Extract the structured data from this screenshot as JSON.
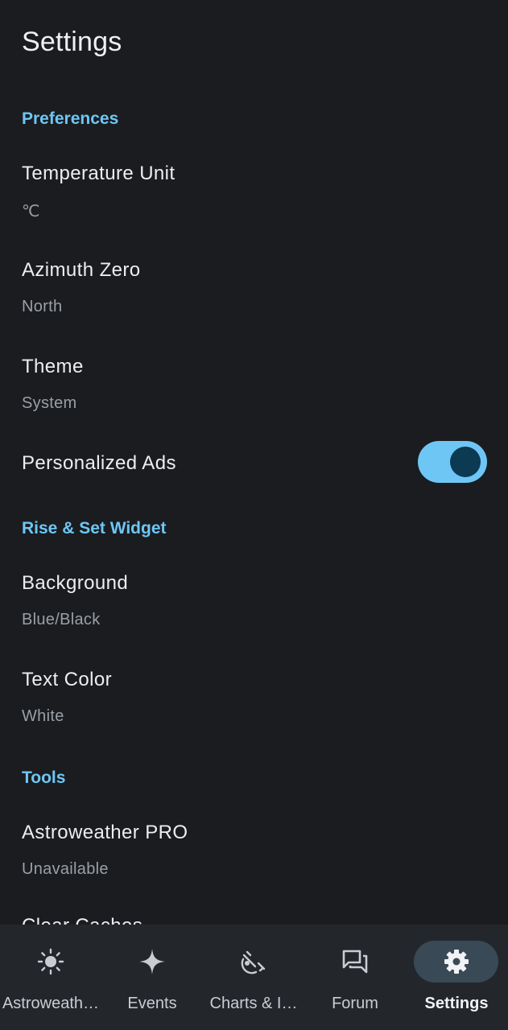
{
  "page": {
    "title": "Settings"
  },
  "sections": {
    "preferences": "Preferences",
    "widget": "Rise & Set Widget",
    "tools": "Tools"
  },
  "prefs": {
    "temperature": {
      "title": "Temperature Unit",
      "summary": "℃"
    },
    "azimuth": {
      "title": "Azimuth Zero",
      "summary": "North"
    },
    "theme": {
      "title": "Theme",
      "summary": "System"
    },
    "ads": {
      "title": "Personalized Ads",
      "enabled": true
    },
    "background": {
      "title": "Background",
      "summary": "Blue/Black"
    },
    "text_color": {
      "title": "Text Color",
      "summary": "White"
    },
    "pro": {
      "title": "Astroweather PRO",
      "summary": "Unavailable"
    },
    "caches": {
      "title": "Clear Caches"
    }
  },
  "nav": {
    "items": [
      {
        "label": "Astroweath…",
        "icon": "sun-icon",
        "active": false
      },
      {
        "label": "Events",
        "icon": "sparkle-icon",
        "active": false
      },
      {
        "label": "Charts & I…",
        "icon": "satellite-dish-icon",
        "active": false
      },
      {
        "label": "Forum",
        "icon": "forum-icon",
        "active": false
      },
      {
        "label": "Settings",
        "icon": "gear-icon",
        "active": true
      }
    ]
  },
  "colors": {
    "background": "#1a1c1f",
    "accent": "#6ec6f5",
    "nav_background": "#23272c",
    "nav_active_pill": "#394955"
  }
}
